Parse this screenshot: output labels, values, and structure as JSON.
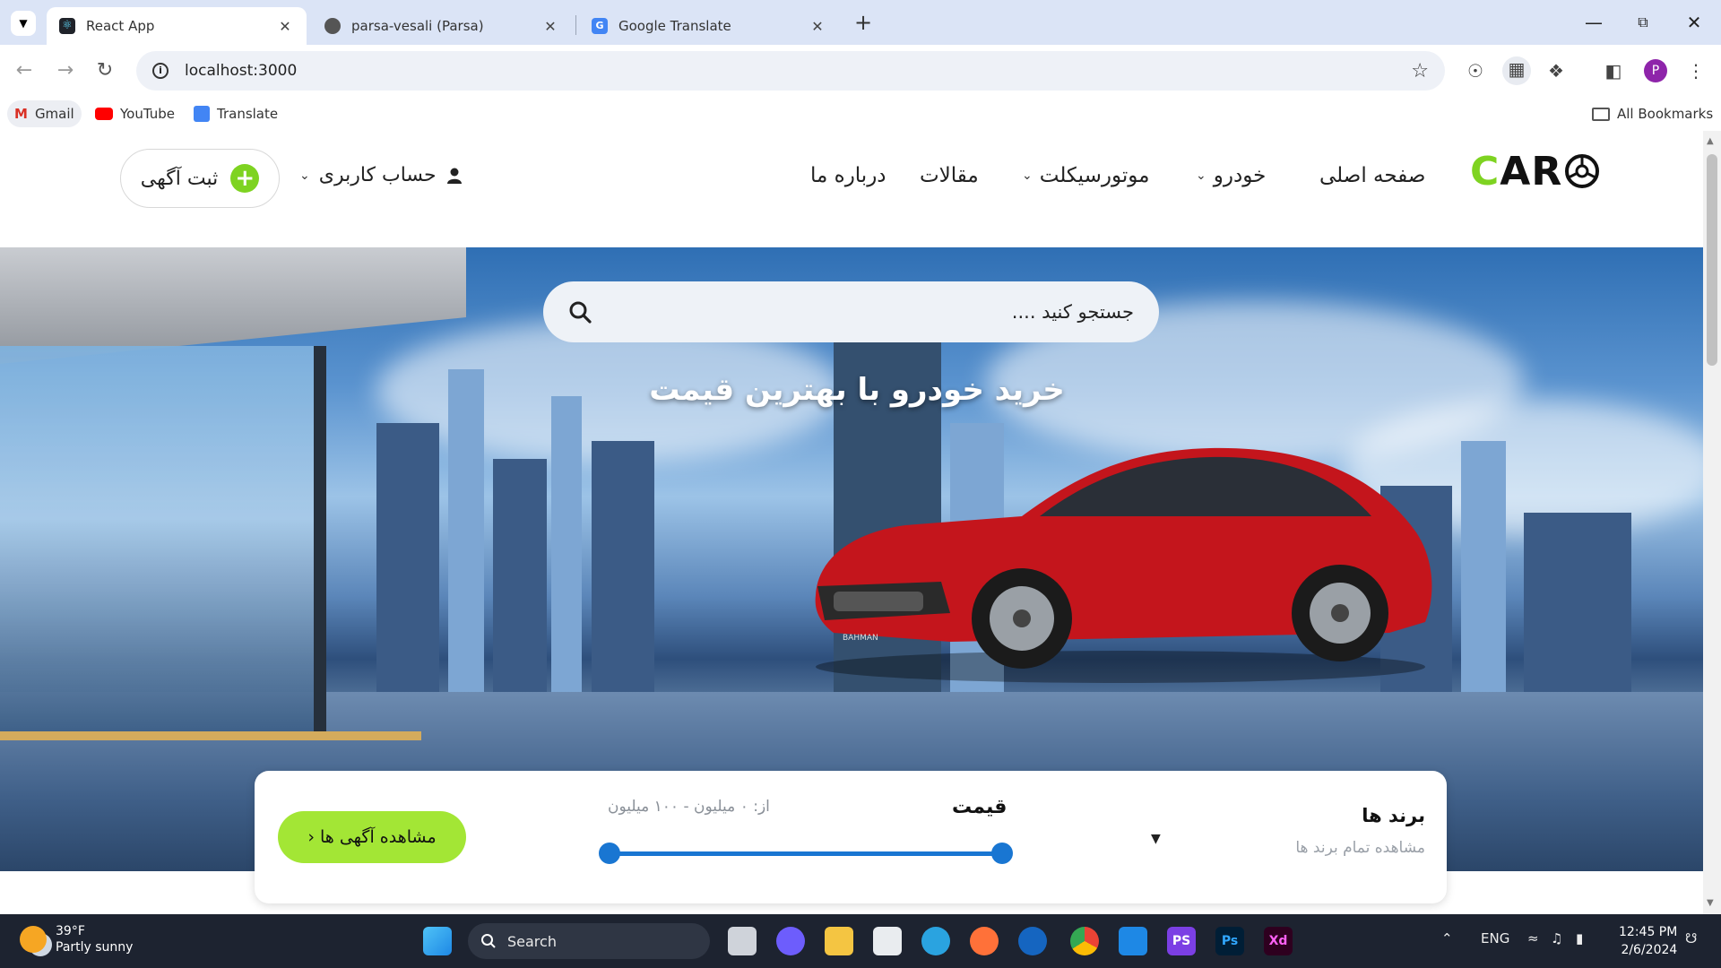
{
  "browser": {
    "tabs": [
      {
        "label": "React App",
        "active": true
      },
      {
        "label": "parsa-vesali (Parsa)",
        "active": false
      },
      {
        "label": "Google Translate",
        "active": false
      }
    ],
    "new_tab": "+",
    "address": "localhost:3000",
    "profile_initial": "P",
    "bookmarks": [
      "Gmail",
      "YouTube",
      "Translate"
    ],
    "all_bookmarks": "All Bookmarks"
  },
  "site": {
    "logo": {
      "first": "C",
      "rest": "AR"
    },
    "nav": [
      "صفحه اصلی",
      "خودرو",
      "موتورسیکلت",
      "مقالات",
      "درباره ما"
    ],
    "account": "حساب کاربری",
    "post_ad": "ثبت آگهی"
  },
  "hero": {
    "search_placeholder": "جستجو کنید ....",
    "title": "خرید خودرو با بهترین قیمت",
    "car_badge": "BAHMAN"
  },
  "filter": {
    "brands_title": "برند ها",
    "brands_sub": "مشاهده تمام برند ها",
    "price_label": "قیمت",
    "price_range": "از: ۰ میلیون - ۱۰۰ میلیون",
    "price_min": 0,
    "price_max": 100,
    "view_ads": "مشاهده آگهی ها ‹"
  },
  "taskbar": {
    "weather_temp": "39°F",
    "weather_desc": "Partly sunny",
    "search": "Search",
    "lang": "ENG",
    "time": "12:45 PM",
    "date": "2/6/2024"
  },
  "colors": {
    "accent_green": "#7ed321",
    "button_green": "#a3e635",
    "slider_blue": "#1976d2",
    "car_red": "#c4151c"
  }
}
